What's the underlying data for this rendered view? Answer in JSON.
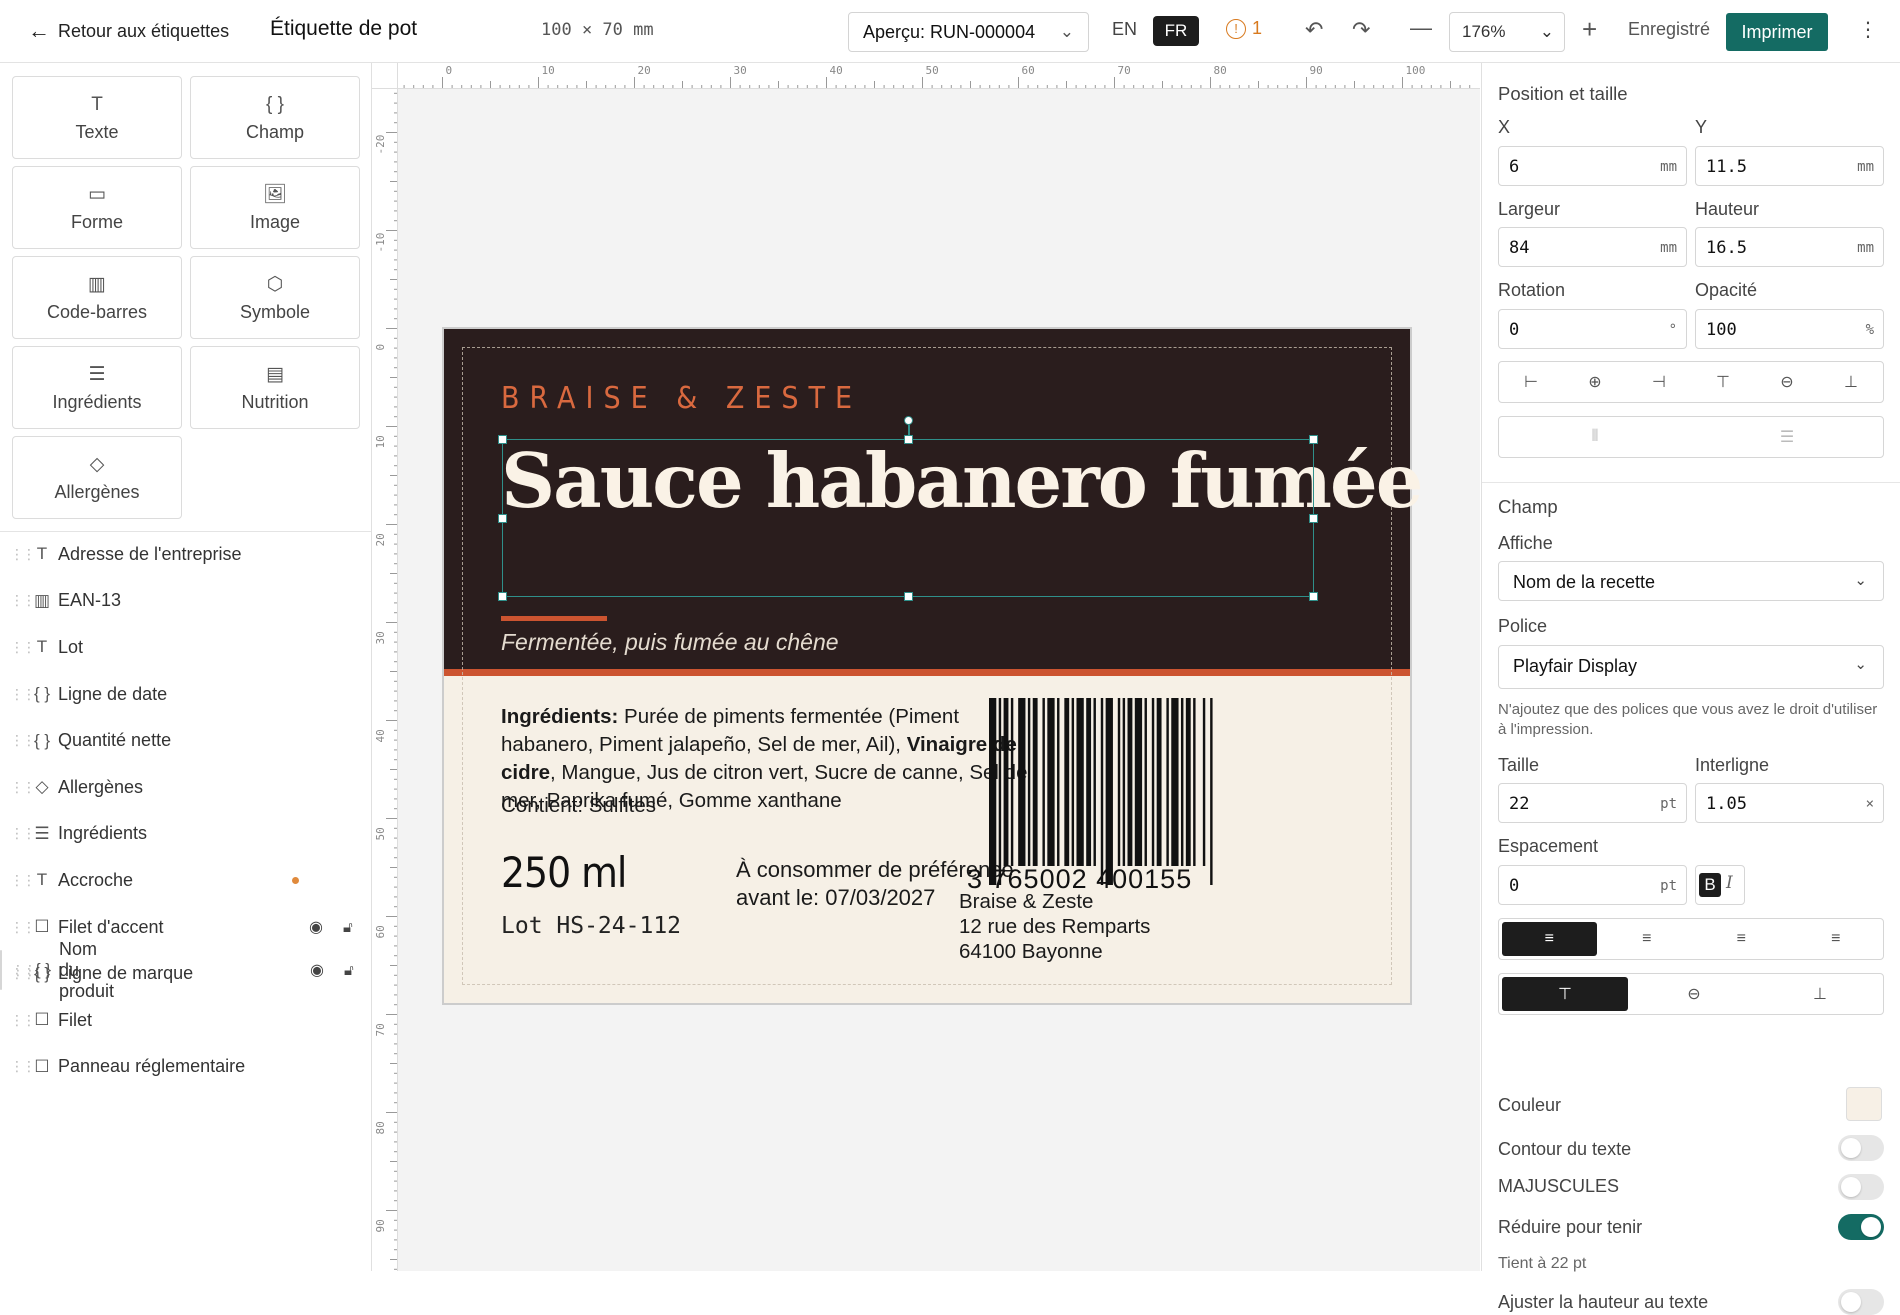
{
  "topbar": {
    "back_label": "Retour aux étiquettes",
    "title": "Étiquette de pot",
    "dimensions": "100 × 70 mm",
    "preview_label": "Aperçu: RUN-000004",
    "lang_en": "EN",
    "lang_fr": "FR",
    "warning_count": "1",
    "zoom": "176%",
    "saved_label": "Enregistré",
    "print_label": "Imprimer"
  },
  "tools": [
    {
      "icon": "T",
      "label": "Texte"
    },
    {
      "icon": "{ }",
      "label": "Champ"
    },
    {
      "icon": "▭",
      "label": "Forme"
    },
    {
      "icon": "🖼",
      "label": "Image"
    },
    {
      "icon": "▥",
      "label": "Code-barres"
    },
    {
      "icon": "⬡",
      "label": "Symbole"
    },
    {
      "icon": "☰",
      "label": "Ingrédients"
    },
    {
      "icon": "▤",
      "label": "Nutrition"
    },
    {
      "icon": "◇",
      "label": "Allergènes"
    }
  ],
  "layers": [
    {
      "icon": "T",
      "name": "Adresse de l'entreprise"
    },
    {
      "icon": "▥",
      "name": "EAN-13"
    },
    {
      "icon": "T",
      "name": "Lot"
    },
    {
      "icon": "{ }",
      "name": "Ligne de date"
    },
    {
      "icon": "{ }",
      "name": "Quantité nette"
    },
    {
      "icon": "◇",
      "name": "Allergènes"
    },
    {
      "icon": "☰",
      "name": "Ingrédients"
    },
    {
      "icon": "T",
      "name": "Accroche"
    },
    {
      "icon": "☐",
      "name": "Filet d'accent"
    },
    {
      "icon": "{ }",
      "name": "Nom du produit"
    },
    {
      "icon": "{ }",
      "name": "Ligne de marque"
    },
    {
      "icon": "☐",
      "name": "Filet"
    },
    {
      "icon": "☐",
      "name": "Panneau réglementaire"
    }
  ],
  "ruler": {
    "h": [
      "0",
      "10",
      "20",
      "30",
      "40",
      "50",
      "60",
      "70",
      "80",
      "90",
      "100"
    ],
    "v": [
      "-20",
      "-10",
      "0",
      "10",
      "20",
      "30",
      "40",
      "50",
      "60",
      "70",
      "80",
      "90"
    ]
  },
  "label": {
    "brand": "BRAISE & ZESTE",
    "title": "Sauce habanero fumée",
    "tagline": "Fermentée, puis fumée au chêne",
    "ingredients_head": "Ingrédients:",
    "ingredients_a": " Purée de piments fermentée (Piment habanero, Piment jalapeño, Sel de mer, Ail), ",
    "ingredients_bold": "Vinaigre de cidre",
    "ingredients_b": ", Mangue, Jus de citron vert, Sucre de canne, Sel de mer, Paprika fumé, Gomme xanthane",
    "contains": "Contient: Sulfites",
    "volume": "250 ml",
    "lot": "Lot HS-24-112",
    "bbd": "À consommer de préférence avant le: 07/03/2027",
    "barcode_digits": "3  765002  400155",
    "company": "Braise & Zeste",
    "street": "12 rue des Remparts",
    "city": "64100 Bayonne",
    "colors": {
      "dark": "#2a1d1d",
      "accent": "#cc5430",
      "cream": "#f6f0e6"
    }
  },
  "panel": {
    "pos_title": "Position et taille",
    "x_label": "X",
    "x_value": "6",
    "y_label": "Y",
    "y_value": "11.5",
    "w_label": "Largeur",
    "w_value": "84",
    "h_label": "Hauteur",
    "h_value": "16.5",
    "rot_label": "Rotation",
    "rot_value": "0",
    "op_label": "Opacité",
    "op_value": "100",
    "unit_mm": "mm",
    "unit_deg": "°",
    "unit_pct": "%",
    "field_title": "Champ",
    "shows_label": "Affiche",
    "shows_value": "Nom de la recette",
    "font_label": "Police",
    "font_value": "Playfair Display",
    "font_note": "N'ajoutez que des polices que vous avez le droit d'utiliser à l'impression.",
    "size_label": "Taille",
    "size_value": "22",
    "unit_pt": "pt",
    "lh_label": "Interligne",
    "lh_value": "1.05",
    "unit_x": "×",
    "spacing_label": "Espacement",
    "spacing_value": "0",
    "bold_label": "B",
    "italic_label": "I",
    "color_label": "Couleur",
    "color_value": "#f7f0e6",
    "outline_label": "Contour du texte",
    "caps_label": "MAJUSCULES",
    "shrink_label": "Réduire pour tenir",
    "fit_note": "Tient à 22 pt",
    "autoheight_label": "Ajuster la hauteur au texte"
  }
}
